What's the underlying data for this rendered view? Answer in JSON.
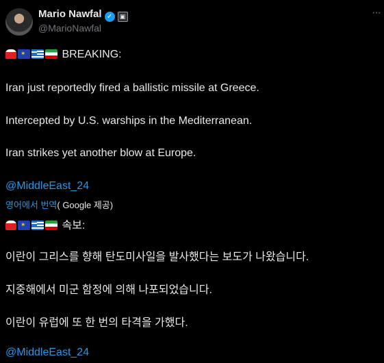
{
  "author": {
    "name": "Mario Nawfal",
    "handle": "@MarioNawfal"
  },
  "icons": {
    "verified": "verified-badge-icon",
    "affiliation": "affiliation-badge-icon",
    "more": "more-options-icon"
  },
  "tweet": {
    "emojis": [
      "siren",
      "eu-flag",
      "greece-flag",
      "iran-flag"
    ],
    "heading": "BREAKING:",
    "line1": "Iran just reportedly fired a ballistic missile at Greece.",
    "line2": "Intercepted by U.S. warships in the Mediterranean.",
    "line3": "Iran strikes yet another blow at Europe.",
    "mention": "@MiddleEast_24"
  },
  "translation": {
    "link_label": "영어에서 번역",
    "provider": "( Google 제공)",
    "heading": "속보:",
    "line1": "이란이 그리스를 향해 탄도미사일을 발사했다는 보도가 나왔습니다.",
    "line2": "지중해에서 미군 함정에 의해 나포되었습니다.",
    "line3": "이란이 유럽에 또 한 번의 타격을 가했다.",
    "mention": "@MiddleEast_24"
  },
  "colors": {
    "background": "#000000",
    "text": "#e7e9ea",
    "muted": "#71767b",
    "link": "#1d9bf0"
  }
}
